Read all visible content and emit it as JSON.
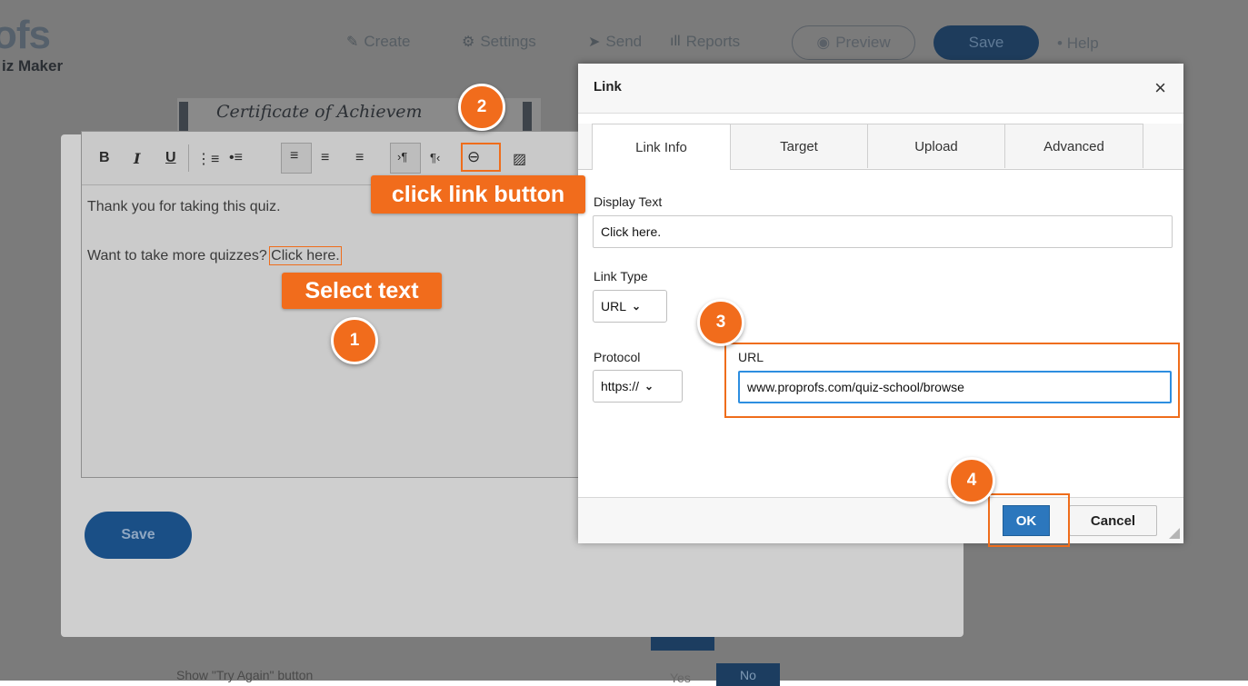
{
  "app": {
    "logo_main": "ofs",
    "logo_sub": "iz Maker",
    "nav": {
      "create": "Create",
      "settings": "Settings",
      "send": "Send",
      "reports": "Reports",
      "preview": "Preview",
      "save": "Save",
      "help": "Help"
    },
    "certificate_title": "Certificate of Achievem",
    "bottom_label": "Show \"Try Again\" button",
    "bottom_yes": "Yes",
    "bottom_no": "No"
  },
  "editor": {
    "toolbar": {
      "bold": "B",
      "italic": "I",
      "underline": "U"
    },
    "line1": "Thank you for taking this quiz.",
    "line2_prefix": "Want to take more quizzes? ",
    "line2_link": "Click here.",
    "save_label": "Save"
  },
  "annotations": {
    "step1": "1",
    "step2": "2",
    "step3": "3",
    "step4": "4",
    "select_text": "Select text",
    "click_link_button": "click link button"
  },
  "dialog": {
    "title": "Link",
    "close": "×",
    "tabs": [
      "Link Info",
      "Target",
      "Upload",
      "Advanced"
    ],
    "display_text_label": "Display Text",
    "display_text_value": "Click here.",
    "link_type_label": "Link Type",
    "link_type_value": "URL",
    "protocol_label": "Protocol",
    "protocol_value": "https://",
    "url_label": "URL",
    "url_value": "www.proprofs.com/quiz-school/browse",
    "ok_label": "OK",
    "cancel_label": "Cancel"
  },
  "colors": {
    "accent_orange": "#f16c1c",
    "ok_blue": "#2c77bd",
    "save_blue": "#1a4f86"
  }
}
